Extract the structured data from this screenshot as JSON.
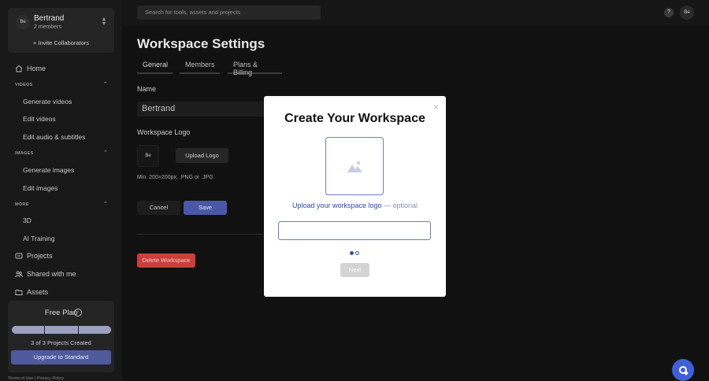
{
  "workspace": {
    "avatar": "Be",
    "name": "Bertrand",
    "members": "2 members",
    "invite": "+ Invite Collaborators"
  },
  "sidebar": {
    "home": "Home",
    "videos_section": "VIDEOS",
    "generate_videos": "Generate videos",
    "edit_videos": "Edit videos",
    "edit_audio": "Edit audio & subtitles",
    "images_section": "IMAGES",
    "generate_images": "Generate images",
    "edit_images": "Edit images",
    "more_section": "MORE",
    "item_3d": "3D",
    "ai_training": "AI Training",
    "projects": "Projects",
    "shared": "Shared with me",
    "assets": "Assets"
  },
  "plan": {
    "title": "Free Plan",
    "info_icon": "i",
    "progress_fraction": 1.0,
    "count_text": "3 of 3 Projects Created",
    "upgrade": "Upgrade to Standard"
  },
  "footer": "Terms of Use  |  Privacy Policy",
  "topbar": {
    "search_placeholder": "Search for tools, assets and projects",
    "help": "?",
    "user_avatar": "Be"
  },
  "main": {
    "title": "Workspace Settings",
    "tabs": [
      "General",
      "Members",
      "Plans & Billing"
    ],
    "name_label": "Name",
    "name_value": "Bertrand",
    "logo_label": "Workspace Logo",
    "logo_preview": "Be",
    "upload_logo": "Upload Logo",
    "hint": "Min. 200×200px, .PNG or .JPG",
    "cancel": "Cancel",
    "save": "Save",
    "delete": "Delete Workspace"
  },
  "modal": {
    "close": "×",
    "title": "Create Your Workspace",
    "upload_text": "Upload your workspace logo",
    "optional": " — optional",
    "next": "Next"
  },
  "colors": {
    "accent": "#4a57a8",
    "danger": "#c9403a",
    "modal_link": "#2f46a8",
    "chat": "#3f5fd8"
  }
}
